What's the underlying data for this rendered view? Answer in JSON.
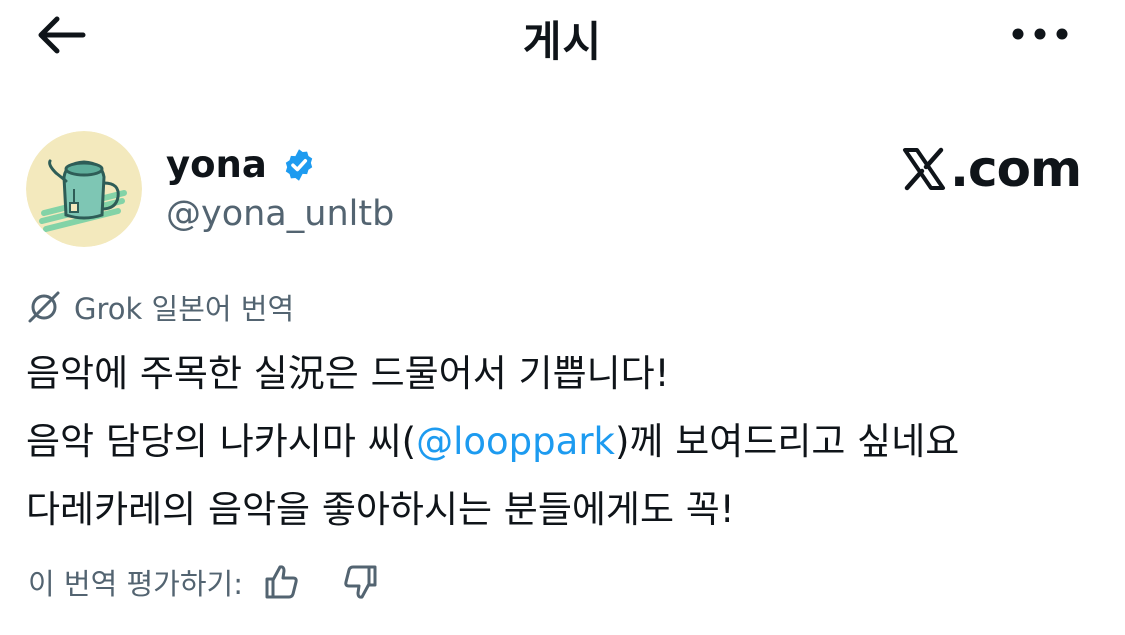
{
  "header": {
    "title": "게시",
    "back_icon": "arrow-left-icon",
    "more_icon": "more-horizontal-icon"
  },
  "author": {
    "display_name": "yona",
    "handle": "@yona_unltb",
    "verified": true,
    "verified_color": "#1d9bf0",
    "avatar_icon": "teapot-avatar"
  },
  "brand": {
    "label": ".com",
    "logo_icon": "x-logo-icon"
  },
  "translation": {
    "label": "Grok 일본어 번역",
    "icon": "grok-icon"
  },
  "tweet": {
    "line1": "음악에 주목한 실況은 드물어서 기쁩니다!",
    "line2_before": "음악 담당의 나카시마 씨(",
    "mention": "@looppark",
    "line2_after": ")께 보여드리고 싶네요",
    "line3": "다레카레의 음악을 좋아하시는 분들에게도 꼭!"
  },
  "rating": {
    "label": "이 번역 평가하기:",
    "up_icon": "thumbs-up-icon",
    "down_icon": "thumbs-down-icon"
  },
  "colors": {
    "text": "#0f1419",
    "secondary": "#536471",
    "link": "#1d9bf0"
  }
}
